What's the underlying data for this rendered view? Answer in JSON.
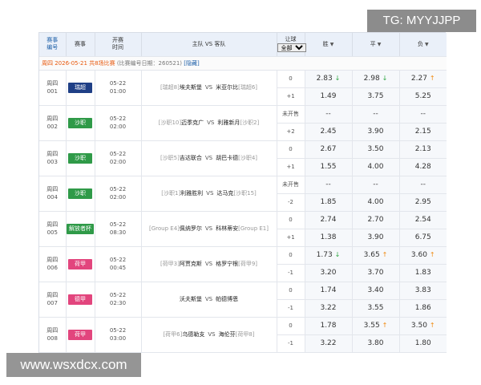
{
  "watermark_top": "TG: MYYJJPP",
  "watermark_bottom": "www.wsxdcx.com",
  "header": {
    "code_line1": "赛事",
    "code_line2": "编号",
    "league": "赛事",
    "time_line1": "开赛",
    "time_line2": "时间",
    "teams": "主队 VS 客队",
    "hcp_label": "让球",
    "hcp_select": "全部",
    "win": "胜",
    "draw": "平",
    "lose": "负"
  },
  "infobar": {
    "date_text": "周四 2026-05-21 共8场比赛",
    "note_text": "(比赛编号日期：260521)",
    "hide_link": "[隐藏]"
  },
  "colors": {
    "blue_badge": "#1f3f86",
    "green_badge": "#2f9a48",
    "pink_badge": "#e2457d",
    "arrow_down": "#2ea643",
    "arrow_up": "#f08a11"
  },
  "matches": [
    {
      "day": "周四",
      "num": "001",
      "league": "瑞超",
      "badge_color": "blue",
      "date": "05-22",
      "time": "01:00",
      "home_rank": "[瑞超8]",
      "home": "埃夫斯堡",
      "vs": "VS",
      "away": "米亚尔比",
      "away_rank": "[瑞超6]",
      "rows": [
        {
          "hcp": "0",
          "win": "2.83",
          "win_arrow": "down",
          "draw": "2.98",
          "draw_arrow": "down",
          "lose": "2.27",
          "lose_arrow": "up"
        },
        {
          "hcp": "+1",
          "win": "1.49",
          "win_arrow": "",
          "draw": "3.75",
          "draw_arrow": "",
          "lose": "5.25",
          "lose_arrow": ""
        }
      ]
    },
    {
      "day": "周四",
      "num": "002",
      "league": "沙职",
      "badge_color": "green",
      "date": "05-22",
      "time": "02:00",
      "home_rank": "[沙职10]",
      "home": "迈季克广",
      "vs": "VS",
      "away": "利雅新月",
      "away_rank": "[沙职2]",
      "rows": [
        {
          "hcp": "未开售",
          "win": "--",
          "win_arrow": "",
          "draw": "--",
          "draw_arrow": "",
          "lose": "--",
          "lose_arrow": ""
        },
        {
          "hcp": "+2",
          "win": "2.45",
          "win_arrow": "",
          "draw": "3.90",
          "draw_arrow": "",
          "lose": "2.15",
          "lose_arrow": ""
        }
      ]
    },
    {
      "day": "周四",
      "num": "003",
      "league": "沙职",
      "badge_color": "green",
      "date": "05-22",
      "time": "02:00",
      "home_rank": "[沙职5]",
      "home": "吉达联合",
      "vs": "VS",
      "away": "胡巴卡德",
      "away_rank": "[沙职4]",
      "rows": [
        {
          "hcp": "0",
          "win": "2.67",
          "win_arrow": "",
          "draw": "3.50",
          "draw_arrow": "",
          "lose": "2.13",
          "lose_arrow": ""
        },
        {
          "hcp": "+1",
          "win": "1.55",
          "win_arrow": "",
          "draw": "4.00",
          "draw_arrow": "",
          "lose": "4.28",
          "lose_arrow": ""
        }
      ]
    },
    {
      "day": "周四",
      "num": "004",
      "league": "沙职",
      "badge_color": "green",
      "date": "05-22",
      "time": "02:00",
      "home_rank": "[沙职1]",
      "home": "利雅胜利",
      "vs": "VS",
      "away": "达马克",
      "away_rank": "[沙职15]",
      "rows": [
        {
          "hcp": "未开售",
          "win": "--",
          "win_arrow": "",
          "draw": "--",
          "draw_arrow": "",
          "lose": "--",
          "lose_arrow": ""
        },
        {
          "hcp": "-2",
          "win": "1.85",
          "win_arrow": "",
          "draw": "4.00",
          "draw_arrow": "",
          "lose": "2.95",
          "lose_arrow": ""
        }
      ]
    },
    {
      "day": "周四",
      "num": "005",
      "league": "解放者杯",
      "badge_color": "green",
      "date": "05-22",
      "time": "08:30",
      "home_rank": "[Group E4]",
      "home": "佩纳罗尔",
      "vs": "VS",
      "away": "科林蒂安",
      "away_rank": "[Group E1]",
      "rows": [
        {
          "hcp": "0",
          "win": "2.74",
          "win_arrow": "",
          "draw": "2.70",
          "draw_arrow": "",
          "lose": "2.54",
          "lose_arrow": ""
        },
        {
          "hcp": "+1",
          "win": "1.38",
          "win_arrow": "",
          "draw": "3.90",
          "draw_arrow": "",
          "lose": "6.75",
          "lose_arrow": ""
        }
      ]
    },
    {
      "day": "周四",
      "num": "006",
      "league": "荷甲",
      "badge_color": "pink",
      "date": "05-22",
      "time": "00:45",
      "home_rank": "[荷甲3]",
      "home": "阿贾克斯",
      "vs": "VS",
      "away": "格罗宁根",
      "away_rank": "[荷甲9]",
      "rows": [
        {
          "hcp": "0",
          "win": "1.73",
          "win_arrow": "down",
          "draw": "3.65",
          "draw_arrow": "up",
          "lose": "3.60",
          "lose_arrow": "up"
        },
        {
          "hcp": "-1",
          "win": "3.20",
          "win_arrow": "",
          "draw": "3.70",
          "draw_arrow": "",
          "lose": "1.83",
          "lose_arrow": ""
        }
      ]
    },
    {
      "day": "周四",
      "num": "007",
      "league": "德甲",
      "badge_color": "pink",
      "date": "05-22",
      "time": "02:30",
      "home_rank": "",
      "home": "沃夫斯堡",
      "vs": "VS",
      "away": "帕德博恩",
      "away_rank": "",
      "rows": [
        {
          "hcp": "0",
          "win": "1.74",
          "win_arrow": "",
          "draw": "3.40",
          "draw_arrow": "",
          "lose": "3.83",
          "lose_arrow": ""
        },
        {
          "hcp": "-1",
          "win": "3.22",
          "win_arrow": "",
          "draw": "3.55",
          "draw_arrow": "",
          "lose": "1.86",
          "lose_arrow": ""
        }
      ]
    },
    {
      "day": "周四",
      "num": "008",
      "league": "荷甲",
      "badge_color": "pink",
      "date": "05-22",
      "time": "03:00",
      "home_rank": "[荷甲6]",
      "home": "乌德勒支",
      "vs": "VS",
      "away": "海伦芬",
      "away_rank": "[荷甲8]",
      "rows": [
        {
          "hcp": "0",
          "win": "1.78",
          "win_arrow": "",
          "draw": "3.55",
          "draw_arrow": "up",
          "lose": "3.50",
          "lose_arrow": "up"
        },
        {
          "hcp": "-1",
          "win": "3.22",
          "win_arrow": "",
          "draw": "3.80",
          "draw_arrow": "",
          "lose": "1.80",
          "lose_arrow": ""
        }
      ]
    }
  ]
}
